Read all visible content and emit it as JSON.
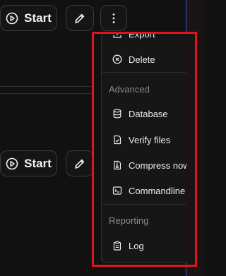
{
  "rows": [
    {
      "start_label": "Start"
    },
    {
      "start_label": "Start"
    }
  ],
  "menu": {
    "clipped_item": "Export",
    "items": [
      {
        "label": "Delete",
        "icon": "x-circle-icon"
      },
      {
        "label": "Database",
        "icon": "database-icon"
      },
      {
        "label": "Verify files",
        "icon": "file-check-icon"
      },
      {
        "label": "Compress now",
        "icon": "file-zip-icon"
      },
      {
        "label": "Commandline",
        "icon": "terminal-icon"
      },
      {
        "label": "Log",
        "icon": "clipboard-icon"
      }
    ],
    "sections": {
      "advanced": "Advanced",
      "reporting": "Reporting"
    }
  },
  "colors": {
    "highlight": "#e0141e",
    "accent_line": "#2f5fd0"
  }
}
